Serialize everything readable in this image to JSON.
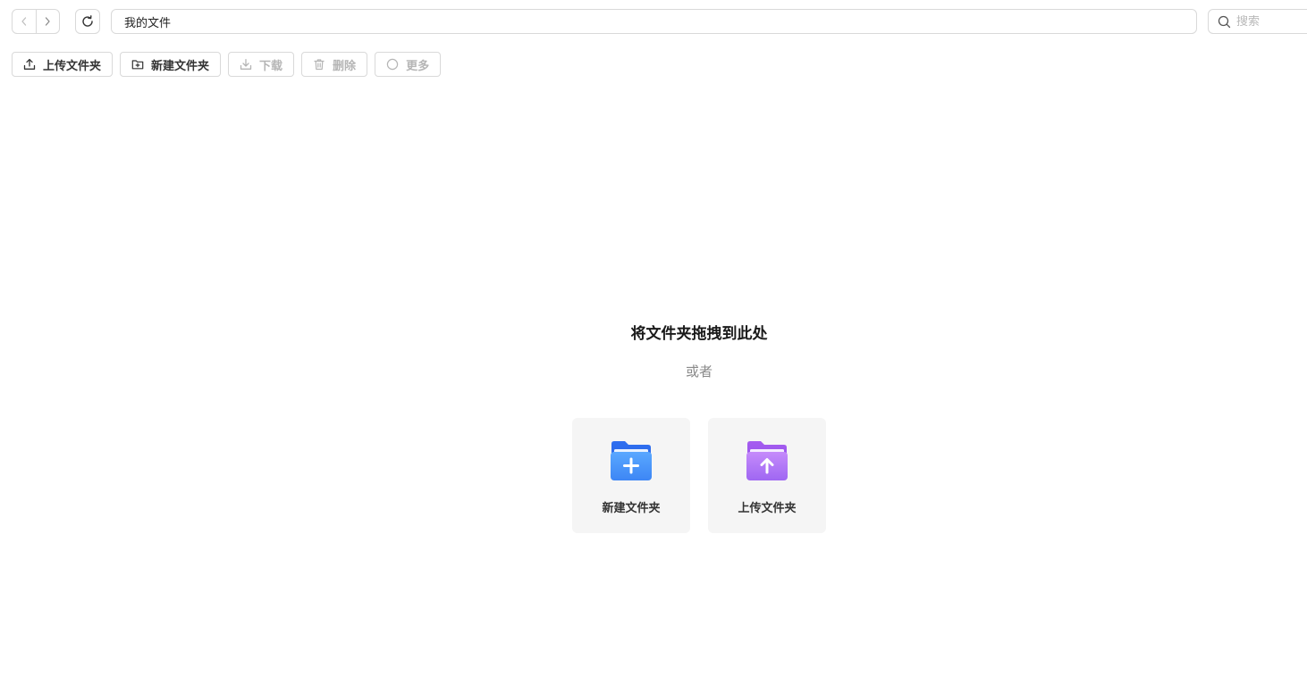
{
  "address": {
    "path": "我的文件"
  },
  "search": {
    "placeholder": "搜索"
  },
  "toolbar": {
    "upload_folder": "上传文件夹",
    "new_folder": "新建文件夹",
    "download": "下载",
    "delete": "删除",
    "more": "更多"
  },
  "empty_state": {
    "title": "将文件夹拖拽到此处",
    "or": "或者",
    "cards": [
      {
        "label": "新建文件夹",
        "icon": "new-folder-icon",
        "color": "#3d8bff"
      },
      {
        "label": "上传文件夹",
        "icon": "upload-folder-icon",
        "color": "#9b6cf7"
      }
    ]
  }
}
